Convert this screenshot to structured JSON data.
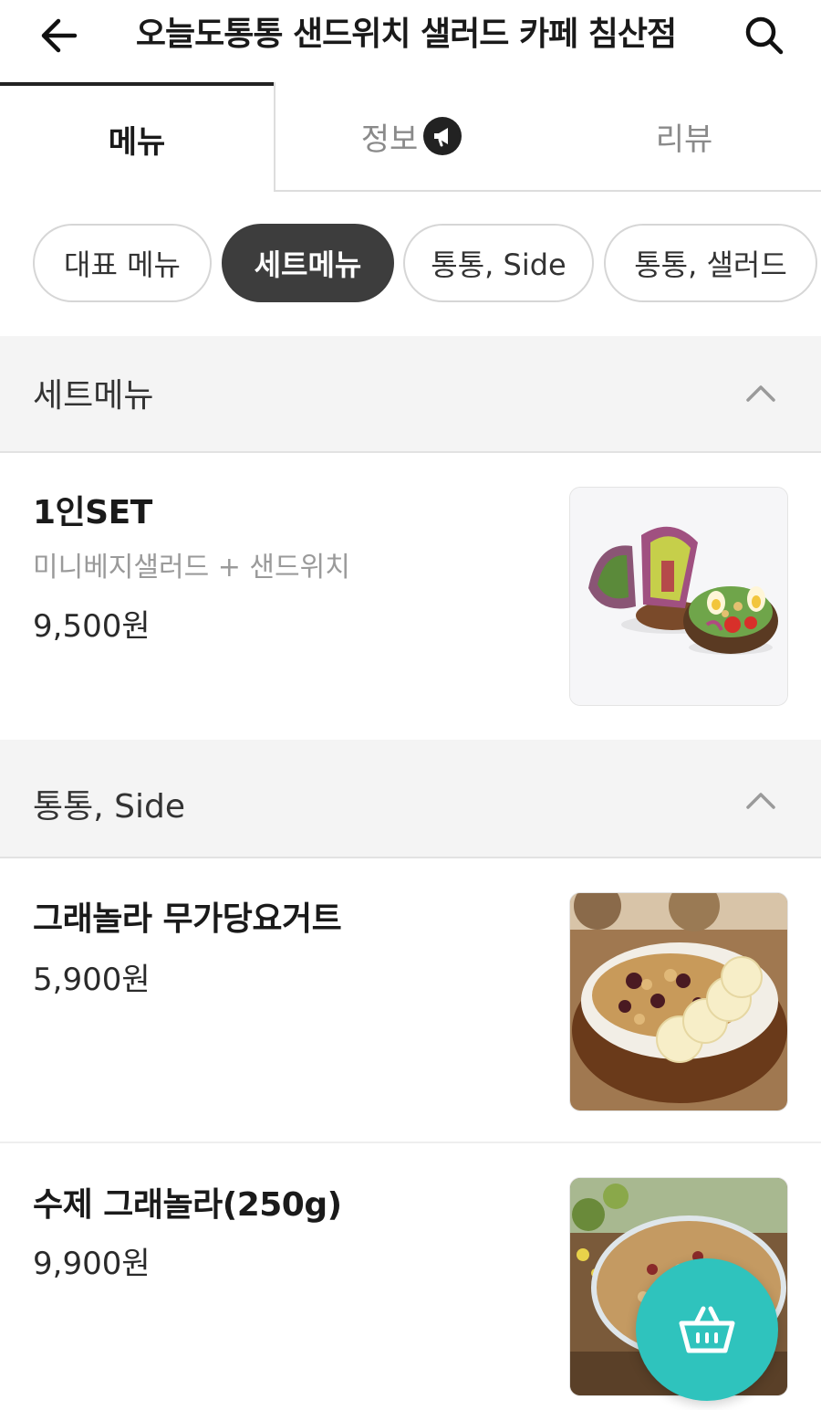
{
  "header": {
    "title": "오늘도통통 샌드위치 샐러드 카페 침산점"
  },
  "tabs": [
    {
      "label": "메뉴"
    },
    {
      "label": "정보"
    },
    {
      "label": "리뷰"
    }
  ],
  "chips": [
    {
      "label": "대표 메뉴"
    },
    {
      "label": "세트메뉴"
    },
    {
      "label": "통통, Side"
    },
    {
      "label": "통통, 샐러드"
    }
  ],
  "sections": [
    {
      "title": "세트메뉴",
      "items": [
        {
          "name": "1인SET",
          "desc": "미니베지샐러드 + 샌드위치",
          "price": "9,500원"
        }
      ]
    },
    {
      "title": "통통, Side",
      "items": [
        {
          "name": "그래놀라 무가당요거트",
          "price": "5,900원"
        },
        {
          "name": "수제 그래놀라(250g)",
          "price": "9,900원"
        }
      ]
    }
  ],
  "colors": {
    "accent": "#2fc3bd",
    "active_chip": "#3d3d3d"
  }
}
